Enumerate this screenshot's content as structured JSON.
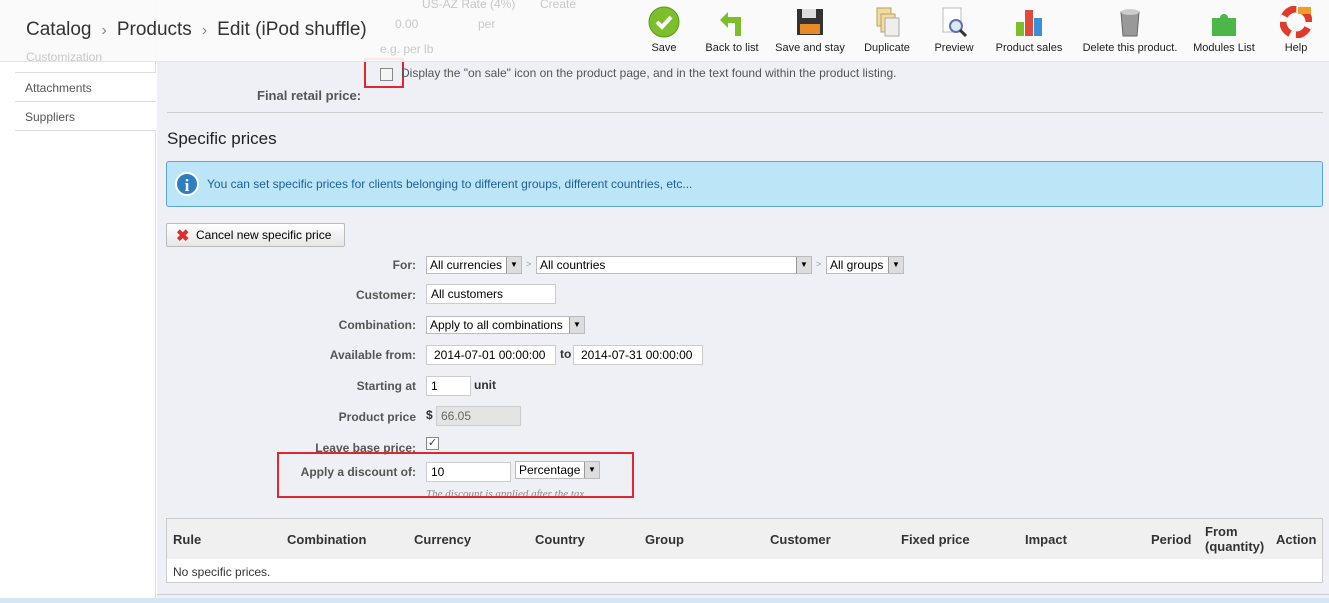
{
  "background_faded": {
    "tax_rule_value": "US-AZ Rate (4%)",
    "create": "Create",
    "unit_price_value": "0.00",
    "per": "per",
    "unit_hint": "e.g. per lb",
    "customization": "Customization"
  },
  "breadcrumb": [
    "Catalog",
    "Products",
    "Edit (iPod shuffle)"
  ],
  "toolbar": [
    {
      "label": "Save",
      "icon": "check-circle-icon"
    },
    {
      "label": "Back to list",
      "icon": "back-arrow-icon"
    },
    {
      "label": "Save and stay",
      "icon": "floppy-disk-icon"
    },
    {
      "label": "Duplicate",
      "icon": "duplicate-icon"
    },
    {
      "label": "Preview",
      "icon": "preview-magnifier-icon"
    },
    {
      "label": "Product sales",
      "icon": "bar-chart-icon"
    },
    {
      "label": "Delete this product.",
      "icon": "trash-icon"
    },
    {
      "label": "Modules List",
      "icon": "puzzle-icon"
    },
    {
      "label": "Help",
      "icon": "lifebuoy-icon"
    }
  ],
  "sidebar": {
    "items": [
      {
        "label": "Attachments"
      },
      {
        "label": "Suppliers"
      }
    ]
  },
  "on_sale": {
    "label": "Display the \"on sale\" icon on the product page, and in the text found within the product listing.",
    "checked": false
  },
  "final_price_label": "Final retail price:",
  "section_title": "Specific prices",
  "info": "You can set specific prices for clients belonging to different groups, different countries, etc...",
  "cancel_button": "Cancel new specific price",
  "form": {
    "for_label": "For:",
    "currency": "All currencies",
    "country": "All countries",
    "group": "All groups",
    "gt": ">",
    "customer_label": "Customer:",
    "customer": "All customers",
    "combination_label": "Combination:",
    "combination": "Apply to all combinations",
    "available_label": "Available from:",
    "from": "2014-07-01 00:00:00",
    "to_label": "to",
    "to": "2014-07-31 00:00:00",
    "starting_label": "Starting at",
    "starting": "1",
    "unit": "unit",
    "price_label": "Product price",
    "currency_symbol": "$",
    "price": "66.05",
    "leave_base_label": "Leave base price:",
    "leave_base_checked": true,
    "discount_label": "Apply a discount of:",
    "discount": "10",
    "discount_type": "Percentage",
    "discount_hint": "The discount is applied after the tax"
  },
  "table": {
    "headers": [
      "Rule",
      "Combination",
      "Currency",
      "Country",
      "Group",
      "Customer",
      "Fixed price",
      "Impact",
      "Period",
      "From (quantity)",
      "Action"
    ],
    "empty": "No specific prices."
  },
  "colors": {
    "highlight": "#e0262e",
    "info_bg": "#bde5f8"
  }
}
